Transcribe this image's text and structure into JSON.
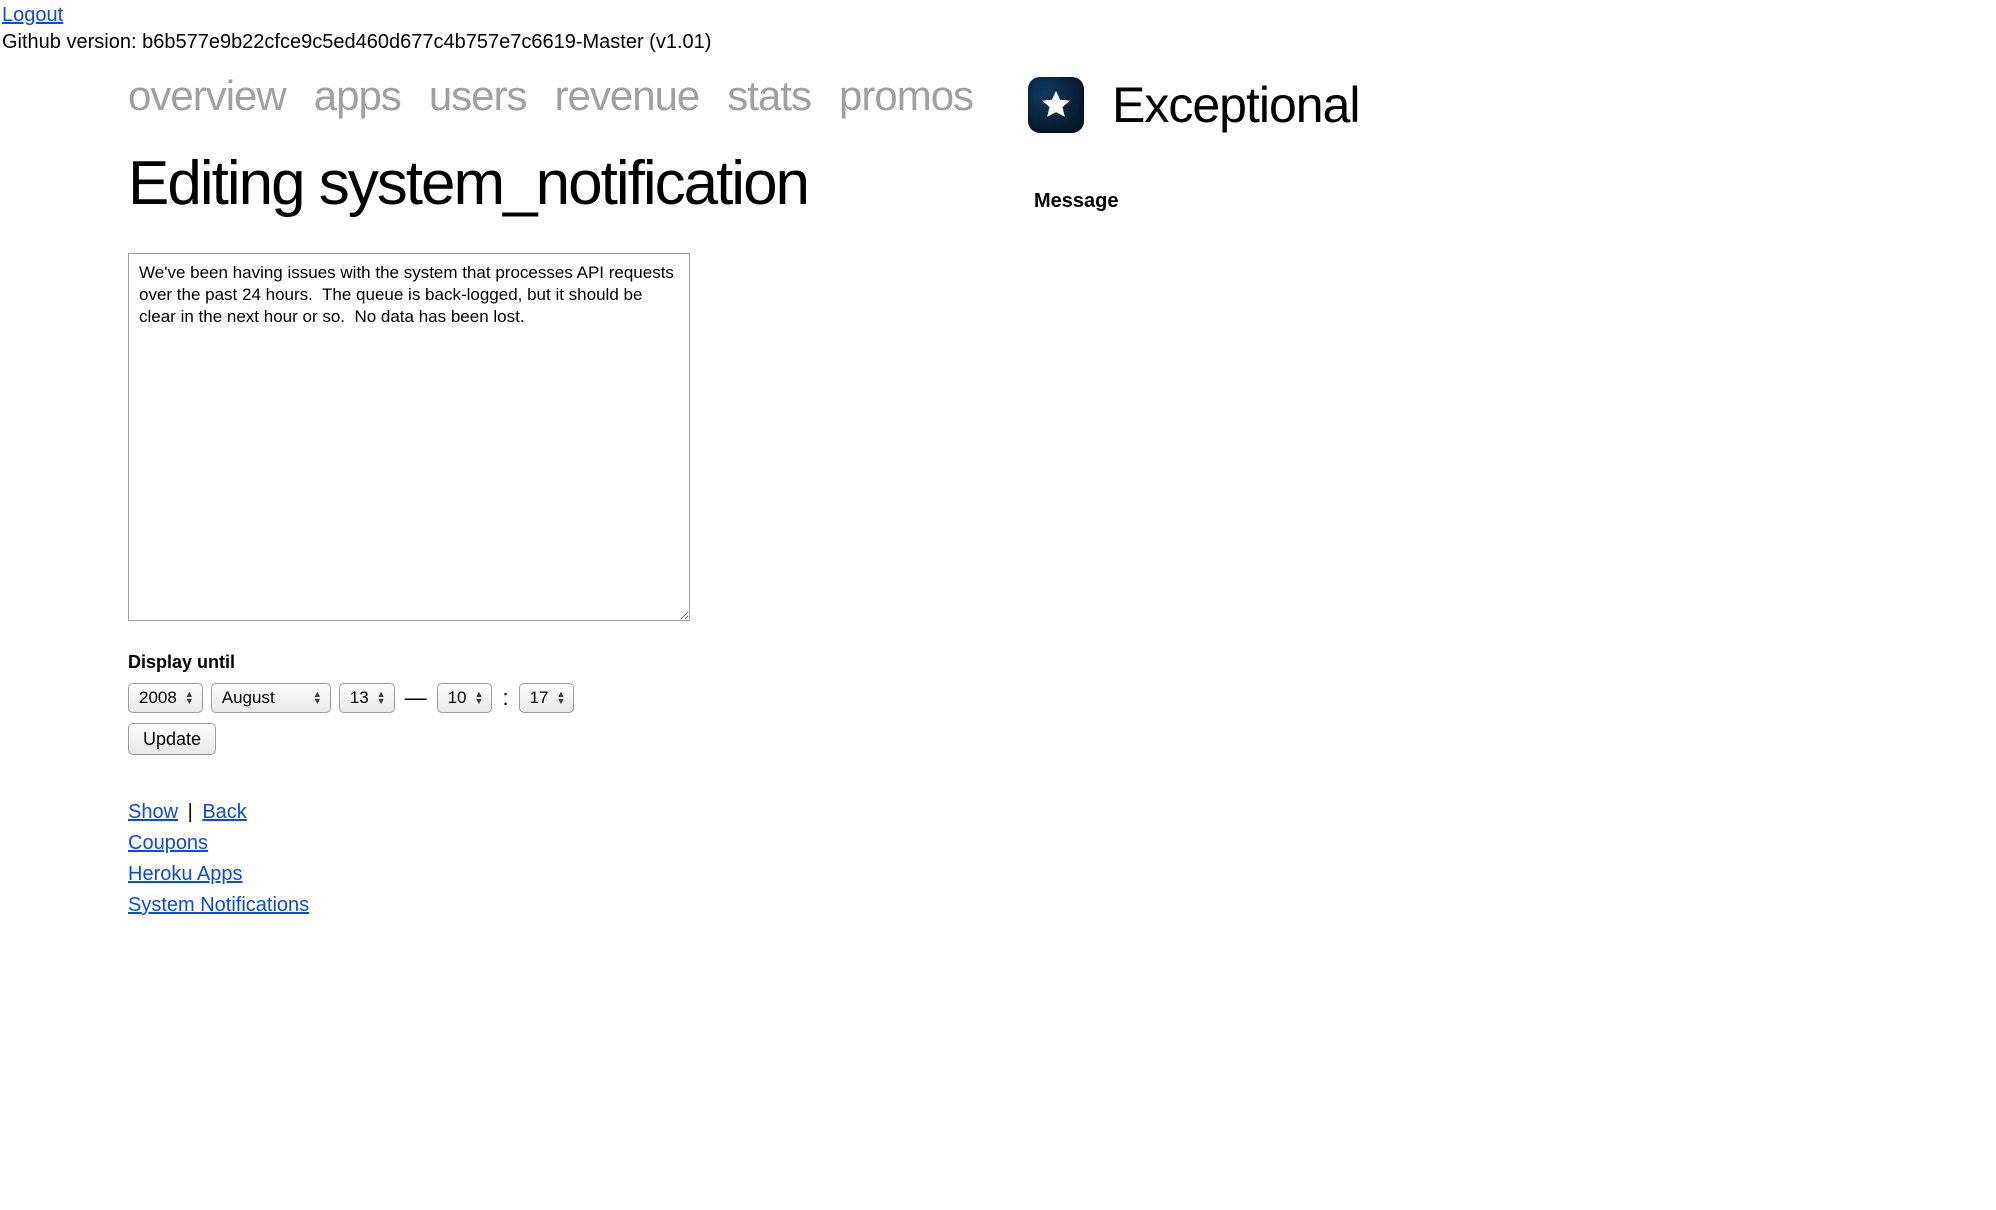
{
  "top_bar": {
    "logout_label": "Logout",
    "github_prefix": "Github version: ",
    "github_hash": "b6b577e9b22cfce9c5ed460d677c4b757e7c6619-Master (v1.01)"
  },
  "nav": {
    "items": [
      {
        "label": "overview"
      },
      {
        "label": "apps"
      },
      {
        "label": "users"
      },
      {
        "label": "revenue"
      },
      {
        "label": "stats"
      },
      {
        "label": "promos"
      }
    ]
  },
  "page": {
    "title": "Editing system_notification"
  },
  "form": {
    "message_value": "We've been having issues with the system that processes API requests over the past 24 hours.  The queue is back-logged, but it should be clear in the next hour or so.  No data has been lost.",
    "display_until_label": "Display until",
    "year": "2008",
    "month": "August",
    "day": "13",
    "hour": "10",
    "minute": "17",
    "dash": "—",
    "colon": ":",
    "update_label": "Update"
  },
  "links": {
    "show": "Show",
    "back": "Back",
    "pipe": " | ",
    "coupons": "Coupons",
    "heroku_apps": "Heroku Apps",
    "system_notifications": "System Notifications"
  },
  "brand": {
    "name": "Exceptional",
    "icon": "star-icon"
  },
  "sidebar": {
    "message_heading": "Message"
  }
}
